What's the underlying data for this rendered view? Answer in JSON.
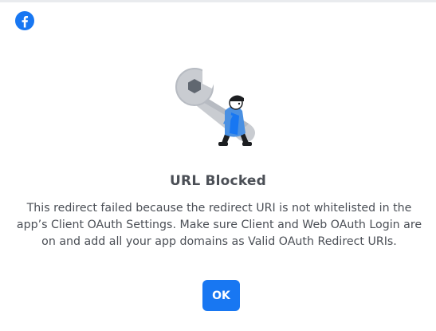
{
  "brand": {
    "logo_icon": "facebook-logo-icon",
    "color": "#1877f2"
  },
  "illustration": {
    "icon": "wrench-and-person-icon"
  },
  "dialog": {
    "title": "URL Blocked",
    "message": "This redirect failed because the redirect URI is not whitelisted in the app’s Client OAuth Settings. Make sure Client and Web OAuth Login are on and add all your app domains as Valid OAuth Redirect URIs.",
    "ok_label": "OK"
  },
  "colors": {
    "text": "#4b4f56",
    "button": "#1877f2",
    "button_text": "#ffffff"
  }
}
